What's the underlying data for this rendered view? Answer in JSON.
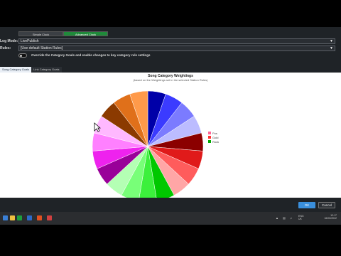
{
  "mode_switch": {
    "simple": "Simple Clock",
    "advanced": "Advanced Clock"
  },
  "log_mode": {
    "label": "Log Mode:",
    "value": "LivePublish"
  },
  "rules": {
    "label": "Rules:",
    "value": "[Use default Station Rules]"
  },
  "override": {
    "label": "Override the Category Goals and enable changes to key category rule settings"
  },
  "tabs": [
    "Song Category Goals",
    "Link Category Goals"
  ],
  "chart": {
    "title": "Song Category Weightings",
    "subtitle": "(based on the Weightings set in the selected Station Rules)"
  },
  "legend": [
    {
      "label": "Pos",
      "color": "#ff6699"
    },
    {
      "label": "Gold",
      "color": "#ff3333"
    },
    {
      "label": "Rock",
      "color": "#00aa00"
    }
  ],
  "buttons": {
    "ok": "OK",
    "cancel": "Cancel"
  },
  "tray": {
    "lang": "ENG",
    "region": "UK",
    "time": "12:17",
    "date": "16/03/2022"
  },
  "chart_data": {
    "type": "pie",
    "title": "Song Category Weightings",
    "subtitle": "(based on the Weightings set in the selected Station Rules)",
    "slices": [
      {
        "value": 1,
        "color": "#0000a8"
      },
      {
        "value": 1,
        "color": "#3b3bff"
      },
      {
        "value": 1,
        "color": "#7b7bff"
      },
      {
        "value": 1,
        "color": "#bcbcff"
      },
      {
        "value": 1,
        "color": "#8b0000"
      },
      {
        "value": 1,
        "color": "#e01a1a"
      },
      {
        "value": 1,
        "color": "#ff5c5c"
      },
      {
        "value": 1,
        "color": "#ffa6a6"
      },
      {
        "value": 1,
        "color": "#00c800"
      },
      {
        "value": 1,
        "color": "#3cf03c"
      },
      {
        "value": 1,
        "color": "#78ff78"
      },
      {
        "value": 1,
        "color": "#b4ffb4"
      },
      {
        "value": 1,
        "color": "#990099"
      },
      {
        "value": 1,
        "color": "#ee22ee"
      },
      {
        "value": 1,
        "color": "#ff80ff"
      },
      {
        "value": 1,
        "color": "#ffb8ff"
      },
      {
        "value": 1,
        "color": "#8b3a00"
      },
      {
        "value": 1,
        "color": "#e0701a"
      },
      {
        "value": 1,
        "color": "#ff9a4a"
      }
    ],
    "legend_placement": "right"
  }
}
